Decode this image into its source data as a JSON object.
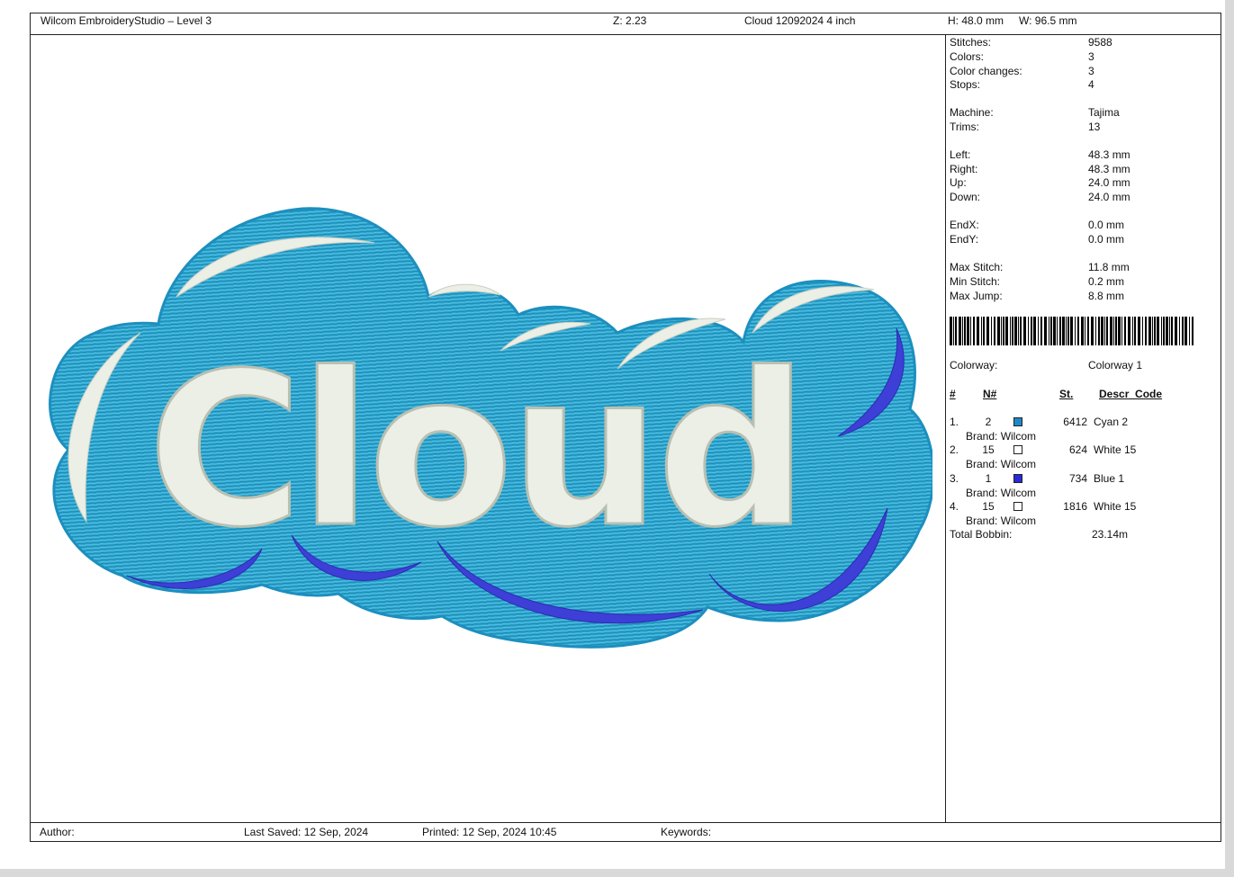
{
  "header": {
    "app_title": "Wilcom EmbroideryStudio – Level 3",
    "zoom": "Z: 2.23",
    "design_name": "Cloud 12092024 4 inch",
    "height": "H: 48.0 mm",
    "width": "W: 96.5 mm"
  },
  "stats": [
    {
      "label": "Stitches:",
      "value": "9588"
    },
    {
      "label": "Colors:",
      "value": "3"
    },
    {
      "label": "Color changes:",
      "value": "3"
    },
    {
      "label": "Stops:",
      "value": "4"
    },
    {
      "label": "Machine:",
      "value": "Tajima"
    },
    {
      "label": "Trims:",
      "value": "13"
    },
    {
      "label": "Left:",
      "value": "48.3 mm"
    },
    {
      "label": "Right:",
      "value": "48.3 mm"
    },
    {
      "label": "Up:",
      "value": "24.0 mm"
    },
    {
      "label": "Down:",
      "value": "24.0 mm"
    },
    {
      "label": "EndX:",
      "value": "0.0 mm"
    },
    {
      "label": "EndY:",
      "value": "0.0 mm"
    },
    {
      "label": "Max Stitch:",
      "value": "11.8 mm"
    },
    {
      "label": "Min Stitch:",
      "value": "0.2 mm"
    },
    {
      "label": "Max Jump:",
      "value": "8.8 mm"
    }
  ],
  "colorway": {
    "label": "Colorway:",
    "value": "Colorway 1"
  },
  "table": {
    "headers": [
      "#",
      "N#",
      "St.",
      "Descr_Code"
    ],
    "rows": [
      {
        "index": "1.",
        "n": "2",
        "swatch": "#1e88c8",
        "stitches": "6412",
        "descr": "Cyan 2",
        "brand": "Brand: Wilcom"
      },
      {
        "index": "2.",
        "n": "15",
        "swatch": "#ffffff",
        "stitches": "624",
        "descr": "White 15",
        "brand": "Brand: Wilcom"
      },
      {
        "index": "3.",
        "n": "1",
        "swatch": "#2a2ad8",
        "stitches": "734",
        "descr": "Blue 1",
        "brand": "Brand: Wilcom"
      },
      {
        "index": "4.",
        "n": "15",
        "swatch": "#ffffff",
        "stitches": "1816",
        "descr": "White 15",
        "brand": "Brand: Wilcom"
      }
    ]
  },
  "total_bobbin": {
    "label": "Total Bobbin:",
    "value": "23.14m"
  },
  "design": {
    "text": "Cloud",
    "fill_color": "#2aa6d0",
    "letter_color": "#ecefe6",
    "accent_color": "#3d3fd6"
  },
  "footer": {
    "author": "Author:",
    "last_saved": "Last Saved: 12 Sep, 2024",
    "printed": "Printed: 12 Sep, 2024 10:45",
    "keywords": "Keywords:"
  }
}
